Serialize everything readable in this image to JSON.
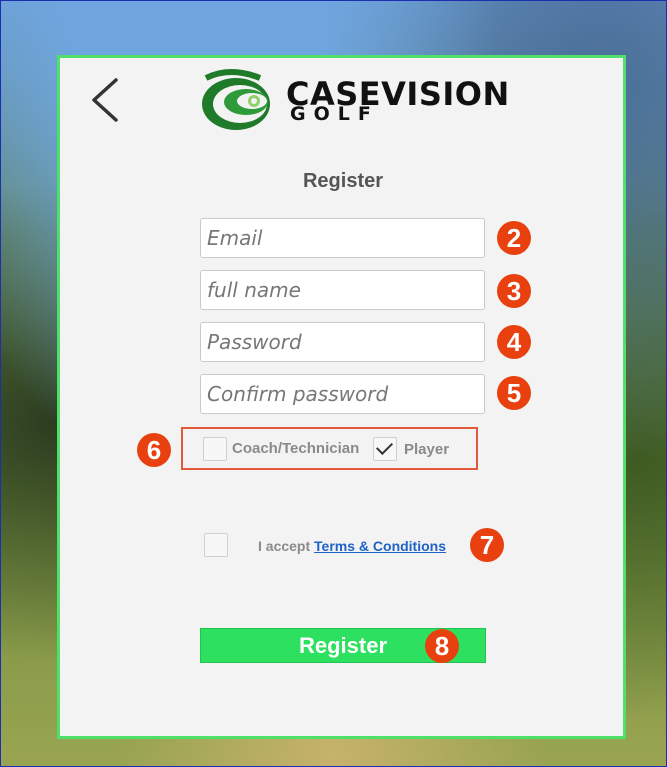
{
  "header": {
    "back_icon": "chevron-left-icon",
    "logo_line1": "CASEVISION",
    "logo_line2": "GOLF"
  },
  "form": {
    "title": "Register",
    "email": {
      "value": "",
      "placeholder": "Email",
      "badge": "2"
    },
    "full_name": {
      "value": "",
      "placeholder": "full name",
      "badge": "3"
    },
    "password": {
      "value": "",
      "placeholder": "Password",
      "badge": "4"
    },
    "confirm_password": {
      "value": "",
      "placeholder": "Confirm password",
      "badge": "5"
    },
    "roles": {
      "badge": "6",
      "coach_label": "Coach/Technician",
      "coach_checked": false,
      "player_label": "Player",
      "player_checked": true
    },
    "terms": {
      "badge": "7",
      "prefix": "I accept",
      "link": "Terms & Conditions",
      "checked": false
    },
    "submit": {
      "label": "Register",
      "badge": "8"
    }
  },
  "colors": {
    "accent_green": "#2de05f",
    "panel_border": "#4ee06a",
    "badge_red": "#e8400f",
    "link_blue": "#1e63c7"
  }
}
